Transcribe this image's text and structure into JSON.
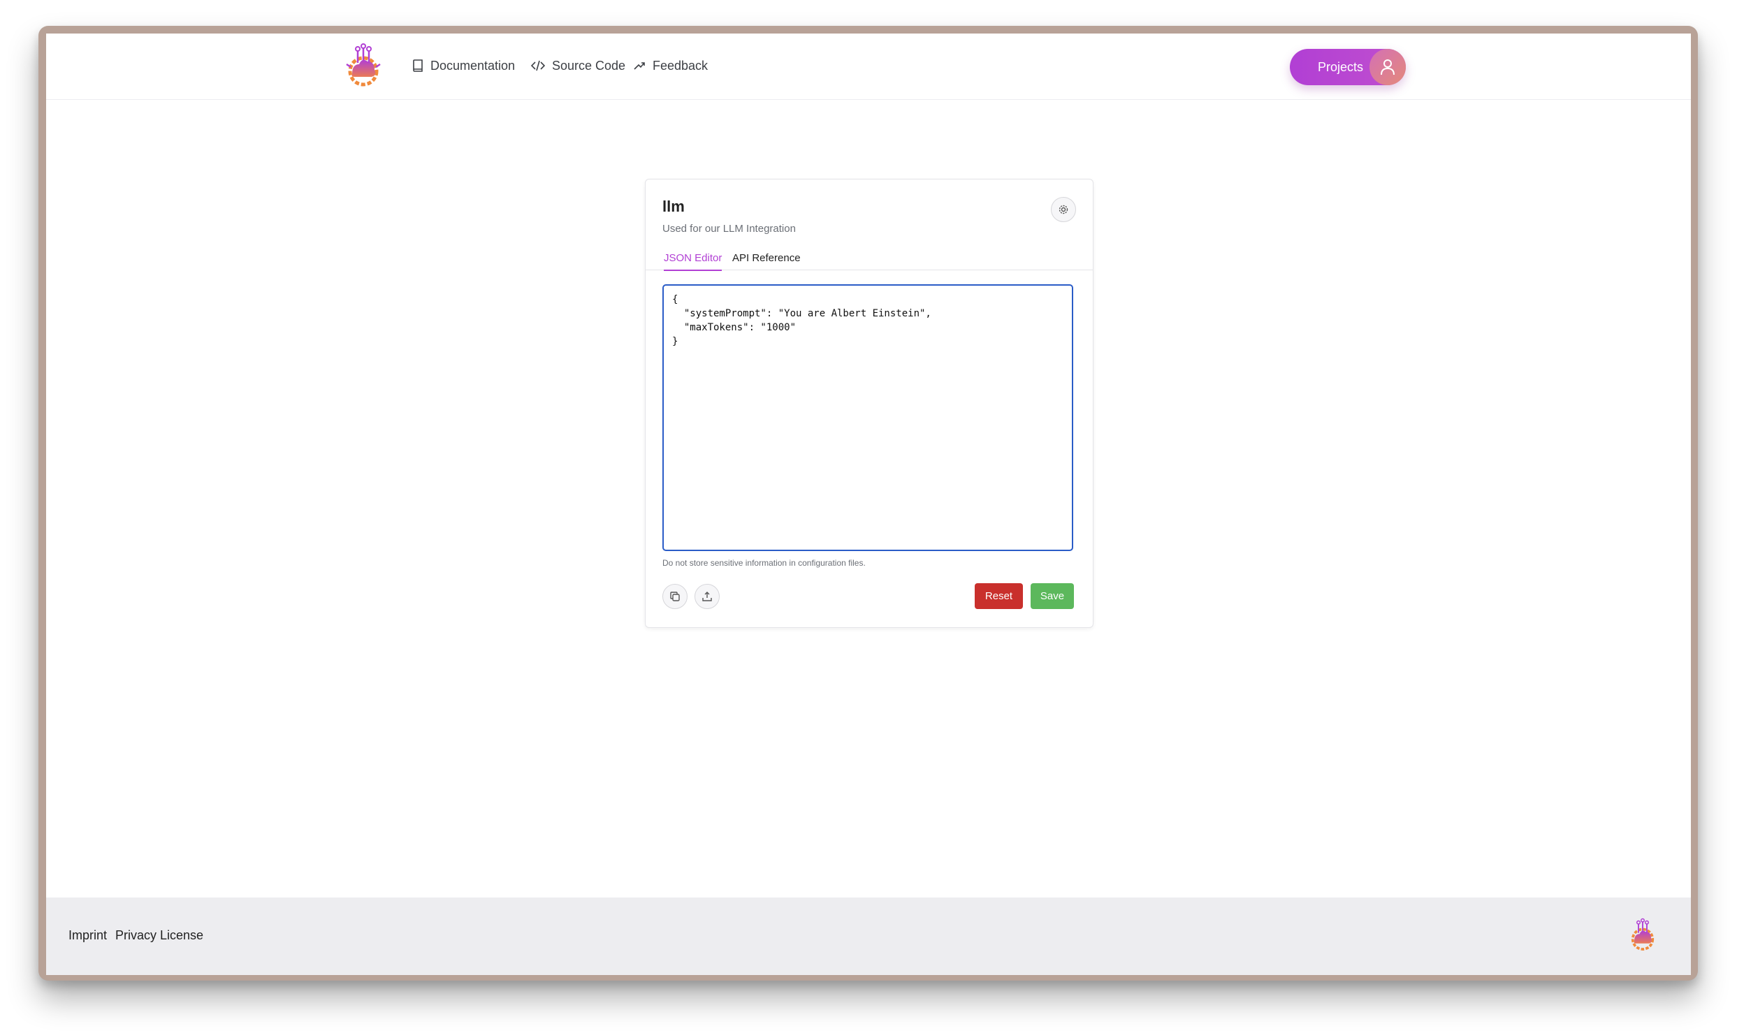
{
  "header": {
    "nav": [
      {
        "label": "Documentation",
        "icon": "book-icon"
      },
      {
        "label": "Source Code",
        "icon": "code-icon"
      },
      {
        "label": "Feedback",
        "icon": "feedback-icon"
      }
    ],
    "projects_label": "Projects",
    "avatar_icon": "user-icon"
  },
  "card": {
    "title": "llm",
    "subtitle": "Used for our LLM Integration",
    "tabs": [
      {
        "label": "JSON Editor",
        "active": true
      },
      {
        "label": "API Reference",
        "active": false
      }
    ],
    "editor_value": "{\n  \"systemPrompt\": \"You are Albert Einstein\",\n  \"maxTokens\": \"1000\"\n}",
    "hint": "Do not store sensitive information in configuration files.",
    "actions": {
      "copy_icon": "copy-icon",
      "upload_icon": "upload-icon",
      "reset_label": "Reset",
      "save_label": "Save"
    }
  },
  "footer": {
    "links": [
      "Imprint",
      "Privacy",
      "License"
    ]
  },
  "colors": {
    "accent": "#b13fd4",
    "reset": "#c9302c",
    "save": "#5cb85c",
    "editor_border": "#2a5cc7"
  }
}
